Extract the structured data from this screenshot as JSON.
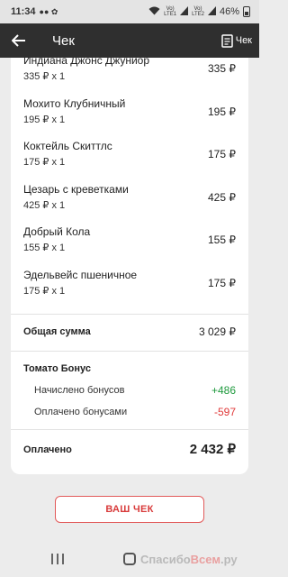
{
  "status_bar": {
    "time": "11:34",
    "notif": "●● ✿",
    "signal1": "Vo)\nLTE1",
    "signal2": "Vo)\nLTE2",
    "battery": "46%"
  },
  "app_bar": {
    "title": "Чек",
    "receipt_label": "Чек"
  },
  "items": [
    {
      "name": "Индиана Джонс Джуниор",
      "sub": "335 ₽ x 1",
      "price": "335 ₽"
    },
    {
      "name": "Мохито Клубничный",
      "sub": "195 ₽ x 1",
      "price": "195 ₽"
    },
    {
      "name": "Коктейль Скиттлс",
      "sub": "175 ₽ x 1",
      "price": "175 ₽"
    },
    {
      "name": "Цезарь с креветками",
      "sub": "425 ₽ x 1",
      "price": "425 ₽"
    },
    {
      "name": "Добрый Кола",
      "sub": "155 ₽ x 1",
      "price": "155 ₽"
    },
    {
      "name": "Эдельвейс пшеничное",
      "sub": "175 ₽ x 1",
      "price": "175 ₽"
    }
  ],
  "total": {
    "label": "Общая сумма",
    "value": "3 029 ₽"
  },
  "bonus": {
    "title": "Томато Бонус",
    "accrued_label": "Начислено бонусов",
    "accrued_value": "+486",
    "paid_label": "Оплачено бонусами",
    "paid_value": "-597"
  },
  "paid": {
    "label": "Оплачено",
    "value": "2 432 ₽"
  },
  "your_receipt_button": "ВАШ ЧЕК",
  "watermark": {
    "part1": "Спасибо",
    "part2": "Всем",
    "part3": ".ру"
  },
  "colors": {
    "plus": "#1f9a3e",
    "minus": "#e03a3a",
    "accent": "#d83a3a",
    "app_bar": "#2f2f2f"
  }
}
